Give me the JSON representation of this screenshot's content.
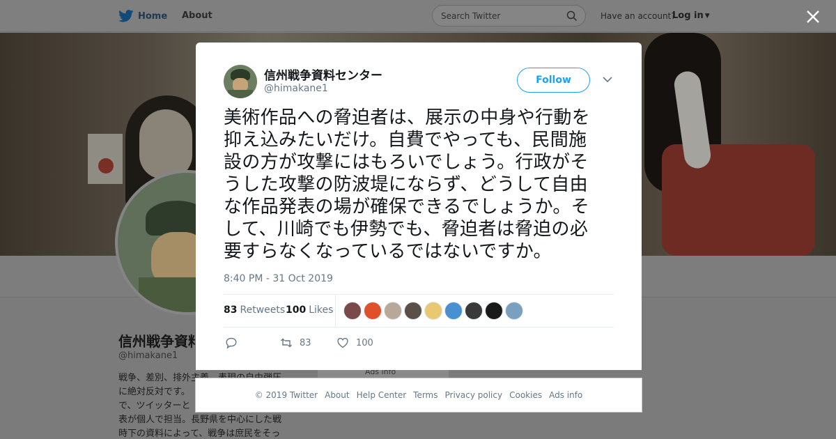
{
  "nav": {
    "home_label": "Home",
    "about_label": "About",
    "search_placeholder": "Search Twitter",
    "have_account": "Have an account?",
    "login_label": "Log in",
    "brand_color": "#1da1f2"
  },
  "background_profile": {
    "name": "信州戦争資料",
    "handle": "@himakane1",
    "bio_lines": [
      "戦争、差別、排外主義、表現の自由弾圧",
      "に絶対反対です。",
      "で、ツイッターと",
      "表が個人で担当。長野県を中心にした戦",
      "時下の資料によって、戦争は庶民をそっ"
    ],
    "ads_info": "Ads info"
  },
  "tweet": {
    "author_name": "信州戦争資料センター",
    "author_handle": "@himakane1",
    "follow_label": "Follow",
    "text_lines": [
      "美術作品への脅迫者は、展示の中身や行動を",
      "抑え込みたいだけ。自費でやっても、民間施",
      "設の方が攻撃にはもろいでしょう。行政がそ",
      "うした攻撃の防波堤にならず、どうして自由",
      "な作品発表の場が確保できるでしょうか。そ",
      "して、川崎でも伊勢でも、脅迫者は脅迫の必",
      "要すらなくなっているではないですか。"
    ],
    "timestamp": "8:40 PM - 31 Oct 2019",
    "retweets_count": "83",
    "retweets_label": "Retweets",
    "likes_count": "100",
    "likes_label": "Likes",
    "action_retweet_count": "83",
    "action_like_count": "100",
    "likers": [
      {
        "color": "#7a4a4a"
      },
      {
        "color": "#e0502a"
      },
      {
        "color": "#b8a89a"
      },
      {
        "color": "#5a5048"
      },
      {
        "color": "#e8c870"
      },
      {
        "color": "#4a90d0"
      },
      {
        "color": "#3a3a3a"
      },
      {
        "color": "#1a1a1a"
      },
      {
        "color": "#7aa0c0"
      }
    ]
  },
  "footer": {
    "items": [
      "© 2019 Twitter",
      "About",
      "Help Center",
      "Terms",
      "Privacy policy",
      "Cookies",
      "Ads info"
    ]
  },
  "icons": {
    "logo": "twitter-bird-icon",
    "search": "search-icon",
    "close": "close-icon",
    "caret": "caret-down-icon",
    "menu": "chevron-down-icon",
    "reply": "reply-icon",
    "retweet": "retweet-icon",
    "like": "heart-icon"
  }
}
